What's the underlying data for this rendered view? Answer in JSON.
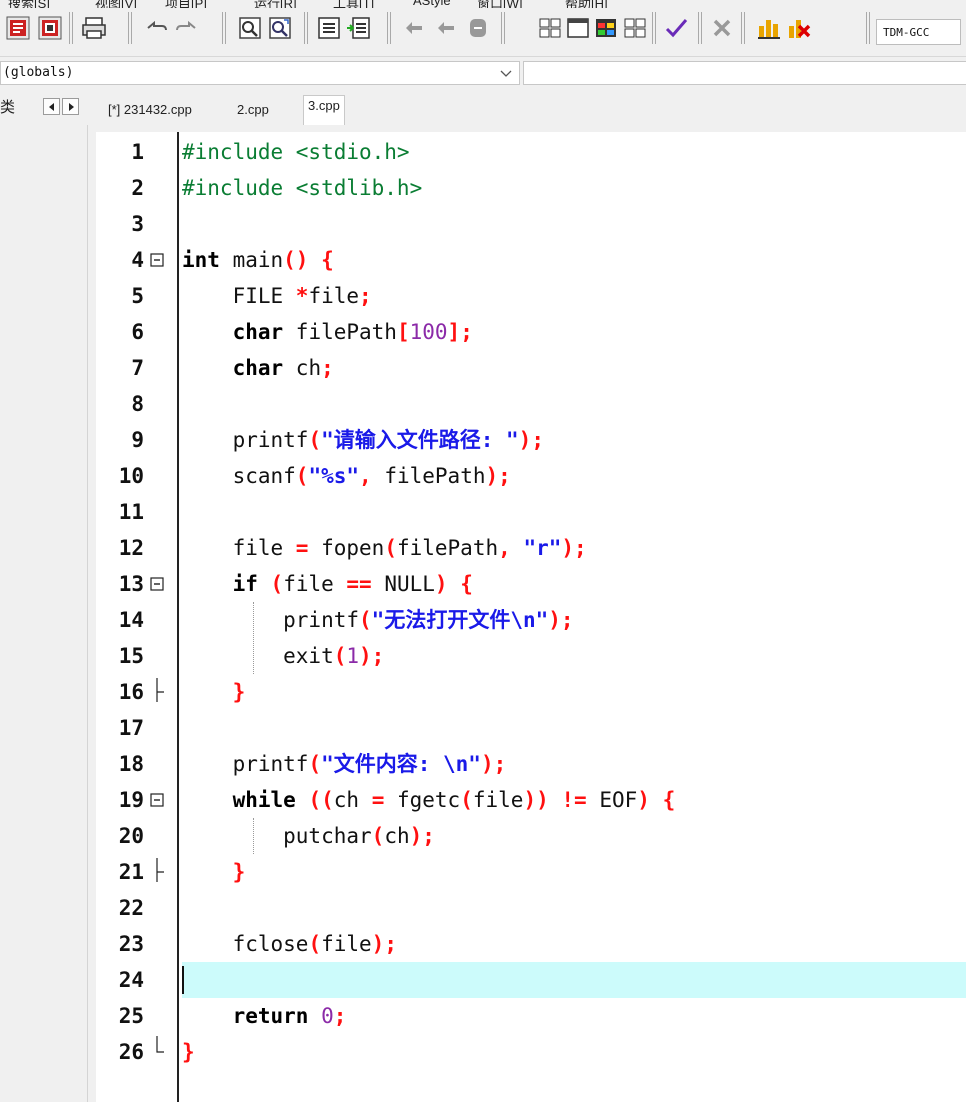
{
  "menubar": {
    "items": [
      "搜索[S]",
      "视图[V]",
      "项目[P]",
      "运行[R]",
      "工具[T]",
      "AStyle",
      "窗口[W]",
      "帮助[H]"
    ]
  },
  "toolbar": {
    "icons": [
      "debug-stop-icon",
      "debug-run-icon",
      "print-icon",
      "undo-icon",
      "redo-icon",
      "find-icon",
      "replace-icon",
      "indent-icon",
      "unindent-icon",
      "bookmark-toggle-icon",
      "bookmark-goto-icon",
      "bookmark-icon",
      "tile-windows-icon",
      "new-window-icon",
      "class-browser-icon",
      "grid-icon",
      "check-icon",
      "delete-icon",
      "chart-icon",
      "profile-delete-icon"
    ],
    "compiler": "TDM-GCC"
  },
  "scope_combo": {
    "value": "(globals)"
  },
  "left_panel": {
    "tab_label": "类"
  },
  "tabs": [
    {
      "label": "[*] 231432.cpp",
      "active": false
    },
    {
      "label": "2.cpp",
      "active": false
    },
    {
      "label": "3.cpp",
      "active": true
    }
  ],
  "editor": {
    "current_line": 24,
    "lines": [
      {
        "n": "1",
        "fold": "",
        "tokens": [
          [
            "pp",
            "#include <stdio.h>"
          ]
        ]
      },
      {
        "n": "2",
        "fold": "",
        "tokens": [
          [
            "pp",
            "#include <stdlib.h>"
          ]
        ]
      },
      {
        "n": "3",
        "fold": "",
        "tokens": []
      },
      {
        "n": "4",
        "fold": "open",
        "tokens": [
          [
            "kw",
            "int"
          ],
          [
            "id",
            " main"
          ],
          [
            "sym",
            "()"
          ],
          [
            "id",
            " "
          ],
          [
            "sym",
            "{"
          ]
        ]
      },
      {
        "n": "5",
        "fold": "",
        "tokens": [
          [
            "id",
            "    FILE "
          ],
          [
            "sym",
            "*"
          ],
          [
            "id",
            "file"
          ],
          [
            "sym",
            ";"
          ]
        ]
      },
      {
        "n": "6",
        "fold": "",
        "tokens": [
          [
            "id",
            "    "
          ],
          [
            "kw",
            "char"
          ],
          [
            "id",
            " filePath"
          ],
          [
            "sym",
            "["
          ],
          [
            "num",
            "100"
          ],
          [
            "sym",
            "];"
          ]
        ]
      },
      {
        "n": "7",
        "fold": "",
        "tokens": [
          [
            "id",
            "    "
          ],
          [
            "kw",
            "char"
          ],
          [
            "id",
            " ch"
          ],
          [
            "sym",
            ";"
          ]
        ]
      },
      {
        "n": "8",
        "fold": "",
        "tokens": []
      },
      {
        "n": "9",
        "fold": "",
        "tokens": [
          [
            "id",
            "    printf"
          ],
          [
            "sym",
            "("
          ],
          [
            "str",
            "\"请输入文件路径: \""
          ],
          [
            "sym",
            ");"
          ]
        ]
      },
      {
        "n": "10",
        "fold": "",
        "tokens": [
          [
            "id",
            "    scanf"
          ],
          [
            "sym",
            "("
          ],
          [
            "str",
            "\"%s\""
          ],
          [
            "sym",
            ","
          ],
          [
            "id",
            " filePath"
          ],
          [
            "sym",
            ");"
          ]
        ]
      },
      {
        "n": "11",
        "fold": "",
        "tokens": []
      },
      {
        "n": "12",
        "fold": "",
        "tokens": [
          [
            "id",
            "    file "
          ],
          [
            "sym",
            "="
          ],
          [
            "id",
            " fopen"
          ],
          [
            "sym",
            "("
          ],
          [
            "id",
            "filePath"
          ],
          [
            "sym",
            ","
          ],
          [
            "id",
            " "
          ],
          [
            "str",
            "\"r\""
          ],
          [
            "sym",
            ");"
          ]
        ]
      },
      {
        "n": "13",
        "fold": "open",
        "tokens": [
          [
            "id",
            "    "
          ],
          [
            "kw",
            "if"
          ],
          [
            "id",
            " "
          ],
          [
            "sym",
            "("
          ],
          [
            "id",
            "file "
          ],
          [
            "sym",
            "=="
          ],
          [
            "id",
            " NULL"
          ],
          [
            "sym",
            ")"
          ],
          [
            "id",
            " "
          ],
          [
            "sym",
            "{"
          ]
        ]
      },
      {
        "n": "14",
        "fold": "",
        "tokens": [
          [
            "id",
            "        printf"
          ],
          [
            "sym",
            "("
          ],
          [
            "str",
            "\"无法打开文件\\n\""
          ],
          [
            "sym",
            ");"
          ]
        ]
      },
      {
        "n": "15",
        "fold": "",
        "tokens": [
          [
            "id",
            "        exit"
          ],
          [
            "sym",
            "("
          ],
          [
            "num",
            "1"
          ],
          [
            "sym",
            ");"
          ]
        ]
      },
      {
        "n": "16",
        "fold": "mid-end",
        "tokens": [
          [
            "id",
            "    "
          ],
          [
            "sym",
            "}"
          ]
        ]
      },
      {
        "n": "17",
        "fold": "",
        "tokens": []
      },
      {
        "n": "18",
        "fold": "",
        "tokens": [
          [
            "id",
            "    printf"
          ],
          [
            "sym",
            "("
          ],
          [
            "str",
            "\"文件内容: \\n\""
          ],
          [
            "sym",
            ");"
          ]
        ]
      },
      {
        "n": "19",
        "fold": "open",
        "tokens": [
          [
            "id",
            "    "
          ],
          [
            "kw",
            "while"
          ],
          [
            "id",
            " "
          ],
          [
            "sym",
            "(("
          ],
          [
            "id",
            "ch "
          ],
          [
            "sym",
            "="
          ],
          [
            "id",
            " fgetc"
          ],
          [
            "sym",
            "("
          ],
          [
            "id",
            "file"
          ],
          [
            "sym",
            "))"
          ],
          [
            "id",
            " "
          ],
          [
            "sym",
            "!="
          ],
          [
            "id",
            " EOF"
          ],
          [
            "sym",
            ")"
          ],
          [
            "id",
            " "
          ],
          [
            "sym",
            "{"
          ]
        ]
      },
      {
        "n": "20",
        "fold": "",
        "tokens": [
          [
            "id",
            "        putchar"
          ],
          [
            "sym",
            "("
          ],
          [
            "id",
            "ch"
          ],
          [
            "sym",
            ");"
          ]
        ]
      },
      {
        "n": "21",
        "fold": "mid-end",
        "tokens": [
          [
            "id",
            "    "
          ],
          [
            "sym",
            "}"
          ]
        ]
      },
      {
        "n": "22",
        "fold": "",
        "tokens": []
      },
      {
        "n": "23",
        "fold": "",
        "tokens": [
          [
            "id",
            "    fclose"
          ],
          [
            "sym",
            "("
          ],
          [
            "id",
            "file"
          ],
          [
            "sym",
            ");"
          ]
        ]
      },
      {
        "n": "24",
        "fold": "",
        "tokens": []
      },
      {
        "n": "25",
        "fold": "",
        "tokens": [
          [
            "id",
            "    "
          ],
          [
            "kw",
            "return"
          ],
          [
            "id",
            " "
          ],
          [
            "num",
            "0"
          ],
          [
            "sym",
            ";"
          ]
        ]
      },
      {
        "n": "26",
        "fold": "end",
        "tokens": [
          [
            "sym",
            "}"
          ]
        ]
      }
    ]
  },
  "colors": {
    "preprocessor": "#0a7d33",
    "symbol": "#ff1010",
    "string": "#1a1ae8",
    "number": "#8b2aa8",
    "current_line_bg": "#ccfbfb"
  }
}
